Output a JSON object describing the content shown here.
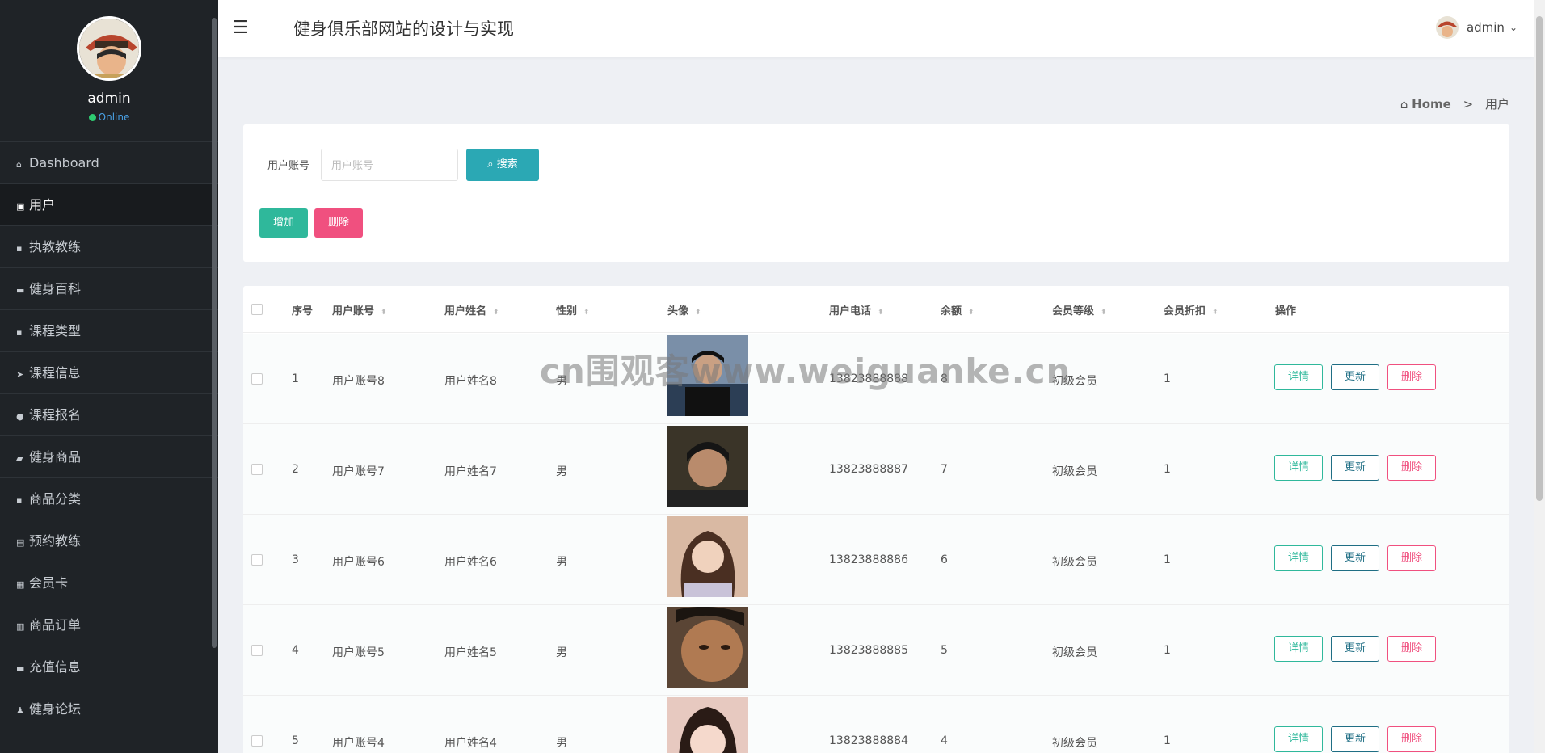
{
  "app_title": "健身俱乐部网站的设计与实现",
  "profile": {
    "name": "admin",
    "status": "Online"
  },
  "header": {
    "user": "admin"
  },
  "sidebar": {
    "items": [
      {
        "label": "Dashboard",
        "icon": "home-icon"
      },
      {
        "label": "用户",
        "icon": "clipboard-icon"
      },
      {
        "label": "执教教练",
        "icon": "grid-icon"
      },
      {
        "label": "健身百科",
        "icon": "briefcase-icon"
      },
      {
        "label": "课程类型",
        "icon": "grid-icon"
      },
      {
        "label": "课程信息",
        "icon": "send-icon"
      },
      {
        "label": "课程报名",
        "icon": "pin-icon"
      },
      {
        "label": "健身商品",
        "icon": "ticket-icon"
      },
      {
        "label": "商品分类",
        "icon": "grid-icon"
      },
      {
        "label": "预约教练",
        "icon": "document-icon"
      },
      {
        "label": "会员卡",
        "icon": "apps-icon"
      },
      {
        "label": "商品订单",
        "icon": "chart-icon"
      },
      {
        "label": "充值信息",
        "icon": "comment-icon"
      },
      {
        "label": "健身论坛",
        "icon": "user-icon"
      }
    ]
  },
  "breadcrumb": {
    "home": "Home",
    "sep": ">",
    "current": "用户"
  },
  "search": {
    "label": "用户账号",
    "placeholder": "用户账号",
    "value": "",
    "button": "搜索"
  },
  "actions": {
    "add": "增加",
    "delete": "删除"
  },
  "table": {
    "headers": [
      "序号",
      "用户账号",
      "用户姓名",
      "性别",
      "头像",
      "用户电话",
      "余额",
      "会员等级",
      "会员折扣",
      "操作"
    ],
    "row_actions": {
      "detail": "详情",
      "update": "更新",
      "delete": "删除"
    },
    "rows": [
      {
        "index": "1",
        "account": "用户账号8",
        "name": "用户姓名8",
        "gender": "男",
        "phone": "13823888888",
        "balance": "8",
        "level": "初级会员",
        "discount": "1"
      },
      {
        "index": "2",
        "account": "用户账号7",
        "name": "用户姓名7",
        "gender": "男",
        "phone": "13823888887",
        "balance": "7",
        "level": "初级会员",
        "discount": "1"
      },
      {
        "index": "3",
        "account": "用户账号6",
        "name": "用户姓名6",
        "gender": "男",
        "phone": "13823888886",
        "balance": "6",
        "level": "初级会员",
        "discount": "1"
      },
      {
        "index": "4",
        "account": "用户账号5",
        "name": "用户姓名5",
        "gender": "男",
        "phone": "13823888885",
        "balance": "5",
        "level": "初级会员",
        "discount": "1"
      },
      {
        "index": "5",
        "account": "用户账号4",
        "name": "用户姓名4",
        "gender": "男",
        "phone": "13823888884",
        "balance": "4",
        "level": "初级会员",
        "discount": "1"
      }
    ]
  },
  "watermark": "cn围观客www.weiguanke.cn"
}
